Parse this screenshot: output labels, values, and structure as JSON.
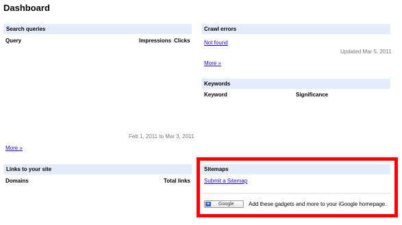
{
  "page": {
    "title": "Dashboard"
  },
  "search_queries": {
    "title": "Search queries",
    "columns": [
      "Query",
      "Impressions",
      "Clicks"
    ],
    "date_range": "Feb 1, 2011 to Mar 3, 2011",
    "more_link": "More »"
  },
  "crawl_errors": {
    "title": "Crawl errors",
    "not_found_link": "Not found",
    "updated": "Updated Mar 5, 2011",
    "more_link": "More »"
  },
  "keywords": {
    "title": "Keywords",
    "columns": [
      "Keyword",
      "Significance"
    ]
  },
  "links_to_site": {
    "title": "Links to your site",
    "columns": [
      "Domains",
      "Total links"
    ]
  },
  "sitemaps": {
    "title": "Sitemaps",
    "submit_link": "Submit a Sitemap",
    "igoogle_button": "Google",
    "igoogle_text": "Add these gadgets and more to your iGoogle homepage."
  },
  "colors": {
    "header_bg": "#e5ecf9",
    "link": "#1a0dab",
    "highlight": "#ff0000"
  }
}
